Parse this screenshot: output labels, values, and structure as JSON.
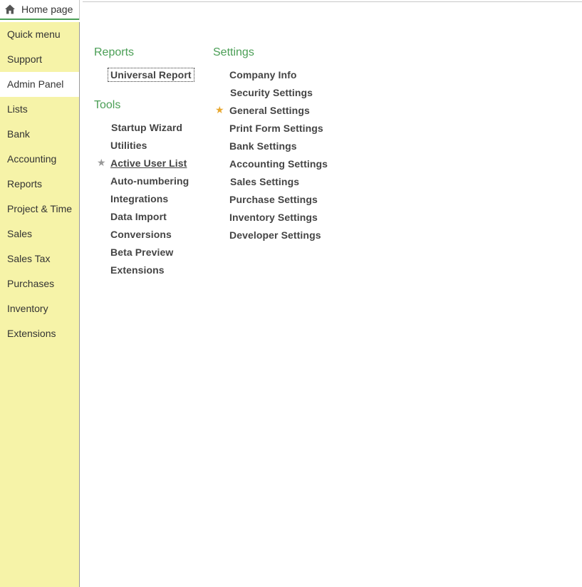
{
  "tab": {
    "label": "Home page",
    "icon": "home-icon"
  },
  "sidebar": {
    "items": [
      {
        "label": "Quick menu"
      },
      {
        "label": "Support"
      },
      {
        "label": "Admin Panel",
        "active": true
      },
      {
        "label": "Lists"
      },
      {
        "label": "Bank"
      },
      {
        "label": "Accounting"
      },
      {
        "label": "Reports"
      },
      {
        "label": "Project & Time"
      },
      {
        "label": "Sales"
      },
      {
        "label": "Sales Tax"
      },
      {
        "label": "Purchases"
      },
      {
        "label": "Inventory"
      },
      {
        "label": "Extensions"
      }
    ]
  },
  "reports": {
    "title": "Reports",
    "links": [
      {
        "label": "Universal Report"
      }
    ]
  },
  "tools": {
    "title": "Tools",
    "links": [
      {
        "label": "Startup Wizard"
      },
      {
        "label": "Utilities"
      },
      {
        "label": "Active User List",
        "starred": true
      },
      {
        "label": "Auto-numbering"
      },
      {
        "label": "Integrations"
      },
      {
        "label": "Data Import"
      },
      {
        "label": "Conversions"
      },
      {
        "label": "Beta Preview"
      },
      {
        "label": "Extensions"
      }
    ]
  },
  "settings": {
    "title": "Settings",
    "links": [
      {
        "label": "Company Info"
      },
      {
        "label": "Security Settings"
      },
      {
        "label": "General Settings",
        "starred": true
      },
      {
        "label": "Print Form Settings"
      },
      {
        "label": "Bank Settings"
      },
      {
        "label": "Accounting Settings"
      },
      {
        "label": "Sales Settings"
      },
      {
        "label": "Purchase Settings"
      },
      {
        "label": "Inventory Settings"
      },
      {
        "label": "Developer Settings"
      }
    ]
  },
  "colors": {
    "sidebar_bg": "#f6f3a8",
    "section_title": "#4a9e55",
    "star_gold": "#e8a830",
    "star_gray": "#999999"
  }
}
